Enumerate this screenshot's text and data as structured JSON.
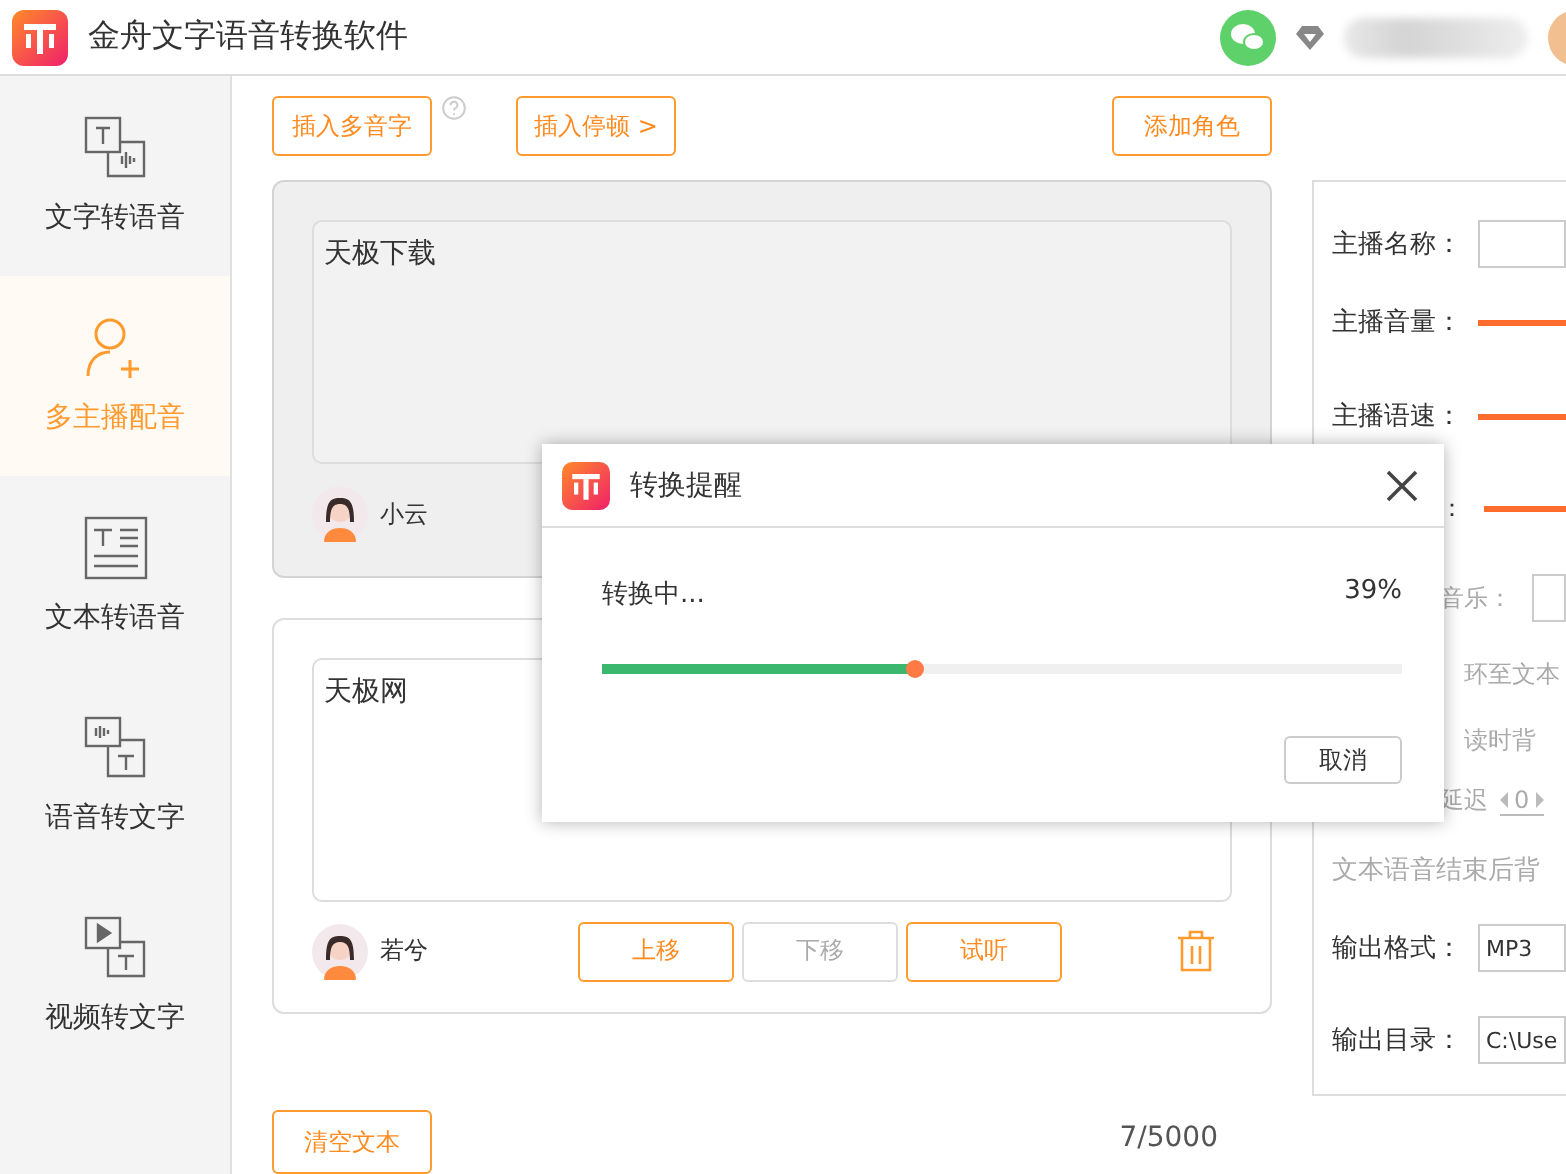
{
  "window": {
    "title": "金舟文字语音转换软件"
  },
  "sidebar": {
    "items": [
      {
        "label": "文字转语音",
        "selected": false
      },
      {
        "label": "多主播配音",
        "selected": true
      },
      {
        "label": "文本转语音",
        "selected": false
      },
      {
        "label": "语音转文字",
        "selected": false
      },
      {
        "label": "视频转文字",
        "selected": false
      }
    ]
  },
  "toolbar": {
    "buttons": [
      "插入多音字",
      "插入停顿 >"
    ],
    "add_button": "添加角色"
  },
  "cards": [
    {
      "text": "天极下载",
      "selected": true,
      "speaker": "小云"
    },
    {
      "text": "天极网",
      "selected": false,
      "speaker": "若兮",
      "buttons": [
        {
          "label": "上移",
          "disabled": false
        },
        {
          "label": "下移",
          "disabled": true
        },
        {
          "label": "试听",
          "disabled": false
        }
      ]
    }
  ],
  "clear_button": "清空文本",
  "char_count": "7/5000",
  "settings": [
    {
      "kind": "field",
      "label": "主播名称：",
      "covered": false,
      "disabled": false
    },
    {
      "kind": "slider",
      "label": "主播音量：",
      "covered": false,
      "disabled": false
    },
    {
      "kind": "slider",
      "label": "主播语速：",
      "covered": false,
      "disabled": false
    },
    {
      "kind": "slider",
      "label": "：",
      "covered": true,
      "disabled": false
    },
    {
      "kind": "field",
      "label": "音乐：",
      "covered": true,
      "disabled": true
    },
    {
      "kind": "text",
      "label": "环至文本",
      "covered": true,
      "disabled": true
    },
    {
      "kind": "text",
      "label": "读时背",
      "covered": true,
      "disabled": true
    },
    {
      "kind": "spinner",
      "label": "延迟",
      "value": "0",
      "covered": true,
      "disabled": true
    },
    {
      "kind": "text",
      "label": "文本语音结束后背",
      "covered": false,
      "disabled": true
    },
    {
      "kind": "select",
      "label": "输出格式：",
      "value": "MP3",
      "covered": false,
      "disabled": false
    },
    {
      "kind": "field",
      "label": "输出目录：",
      "value": "C:\\Use",
      "covered": false,
      "disabled": false
    }
  ],
  "dialog": {
    "title": "转换提醒",
    "status": "转换中...",
    "percent": "39%",
    "level": 0.39,
    "cancel": "取消"
  }
}
